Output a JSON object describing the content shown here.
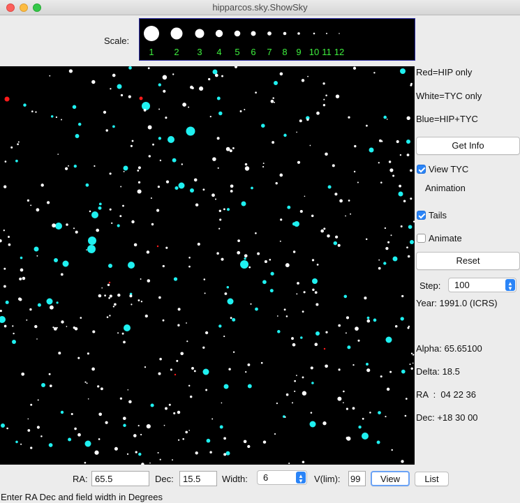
{
  "window": {
    "title": "hipparcos.sky.ShowSky"
  },
  "scale": {
    "label": "Scale:",
    "magnitudes": [
      "1",
      "2",
      "3",
      "4",
      "5",
      "6",
      "7",
      "8",
      "9",
      "10",
      "11",
      "12"
    ],
    "label_color": "#3ef03e"
  },
  "legend": {
    "red": "Red=HIP only",
    "white": "White=TYC only",
    "blue": "Blue=HIP+TYC"
  },
  "colors": {
    "hip_only": "#ff1a1a",
    "tyc_only": "#ffffff",
    "hip_tyc": "#1ff0f0"
  },
  "controls": {
    "get_info": "Get Info",
    "view_tyc": {
      "label": "View TYC",
      "checked": true
    },
    "animation_heading": "Animation",
    "tails": {
      "label": "Tails",
      "checked": true
    },
    "animate": {
      "label": "Animate",
      "checked": false
    },
    "reset": "Reset",
    "step": {
      "label": "Step:",
      "value": "100"
    },
    "year": "Year: 1991.0 (ICRS)"
  },
  "readout": {
    "alpha": "Alpha: 65.65100",
    "delta": "Delta: 18.5",
    "ra": "RA  :  04 22 36",
    "dec": "Dec: +18 30 00"
  },
  "bottom": {
    "ra_label": "RA:",
    "ra_value": "65.5",
    "dec_label": "Dec:",
    "dec_value": "15.5",
    "width_label": "Width:",
    "width_value": "6",
    "vlim_label": "V(lim):",
    "vlim_value": "99",
    "view_button": "View",
    "list_button": "List"
  },
  "status": "Enter RA Dec and field width in Degrees"
}
